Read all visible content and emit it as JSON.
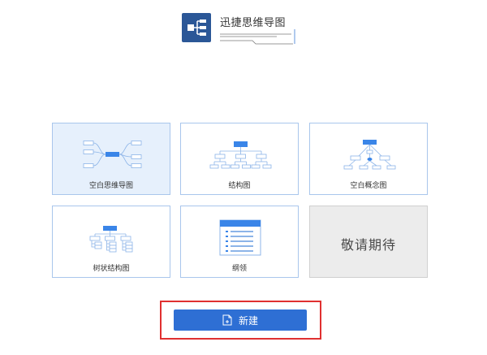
{
  "app": {
    "title": "迅捷思维导图",
    "logo_icon": "mindmap-logo-icon"
  },
  "templates": [
    {
      "id": "blank-mindmap",
      "label": "空白思维导图",
      "icon": "radial-mindmap-icon",
      "selected": true
    },
    {
      "id": "structure",
      "label": "结构图",
      "icon": "org-chart-icon"
    },
    {
      "id": "blank-concept",
      "label": "空白概念图",
      "icon": "concept-map-icon"
    },
    {
      "id": "tree",
      "label": "树状结构图",
      "icon": "tree-structure-icon"
    },
    {
      "id": "outline",
      "label": "纲领",
      "icon": "outline-list-icon"
    },
    {
      "id": "coming-soon",
      "label": "敬请期待",
      "disabled": true
    }
  ],
  "actions": {
    "new_label": "新建",
    "new_icon": "new-file-icon"
  },
  "colors": {
    "accent": "#2e6fd4",
    "card_border": "#a9c6ec",
    "selected_bg": "#e6f0fc",
    "highlight": "#e03030"
  }
}
